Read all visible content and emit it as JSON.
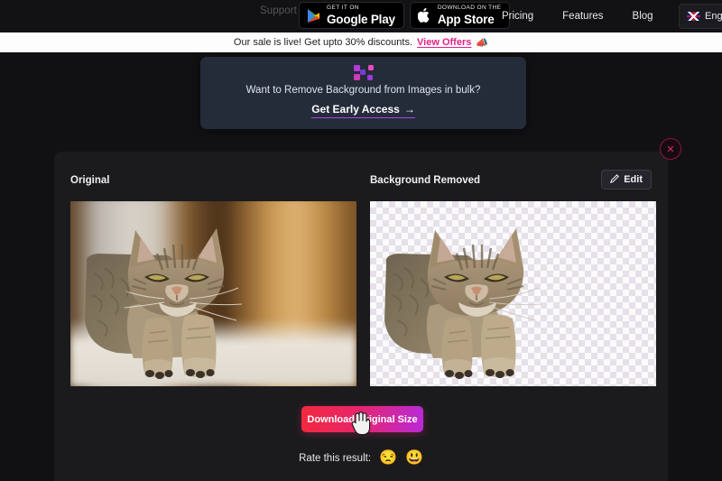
{
  "topnav": {
    "support_label": "Support",
    "badges": [
      {
        "name": "google-play-badge",
        "small": "GET IT ON",
        "big": "Google Play",
        "icon": "google-play-icon"
      },
      {
        "name": "app-store-badge",
        "small": "Download on the",
        "big": "App Store",
        "icon": "apple-icon"
      }
    ],
    "links": [
      {
        "label": "Pricing",
        "name": "nav-link-pricing"
      },
      {
        "label": "Features",
        "name": "nav-link-features"
      },
      {
        "label": "Blog",
        "name": "nav-link-blog"
      }
    ],
    "language": {
      "label": "English",
      "flag": "uk-flag-icon"
    }
  },
  "sale_banner": {
    "message": "Our sale is live! Get upto 30% discounts.",
    "link_label": "View Offers",
    "emoji": "📣",
    "background": "#fdfdfd",
    "link_color": "#e0218a"
  },
  "promo": {
    "icon": "bulk-logo-icon",
    "question": "Want to Remove Background from Images in bulk?",
    "cta_label": "Get Early Access",
    "cta_arrow": "→",
    "background": "#242c3a",
    "underline_color": "#a44ae0"
  },
  "modal": {
    "close_label": "✕",
    "original_label": "Original",
    "removed_label": "Background Removed",
    "edit_label": "Edit",
    "edit_icon": "pencil-icon",
    "original_image_alt": "tabby cat lying down with blurred warm room background",
    "removed_image_alt": "tabby cat cutout on transparent checkerboard",
    "download_label": "Download Original Size",
    "download_gradient_start": "#f1293f",
    "download_gradient_end": "#b92ad6",
    "rate_label": "Rate this result:",
    "rate_options": [
      {
        "emoji": "😒",
        "name": "rate-negative"
      },
      {
        "emoji": "😃",
        "name": "rate-positive"
      }
    ]
  }
}
